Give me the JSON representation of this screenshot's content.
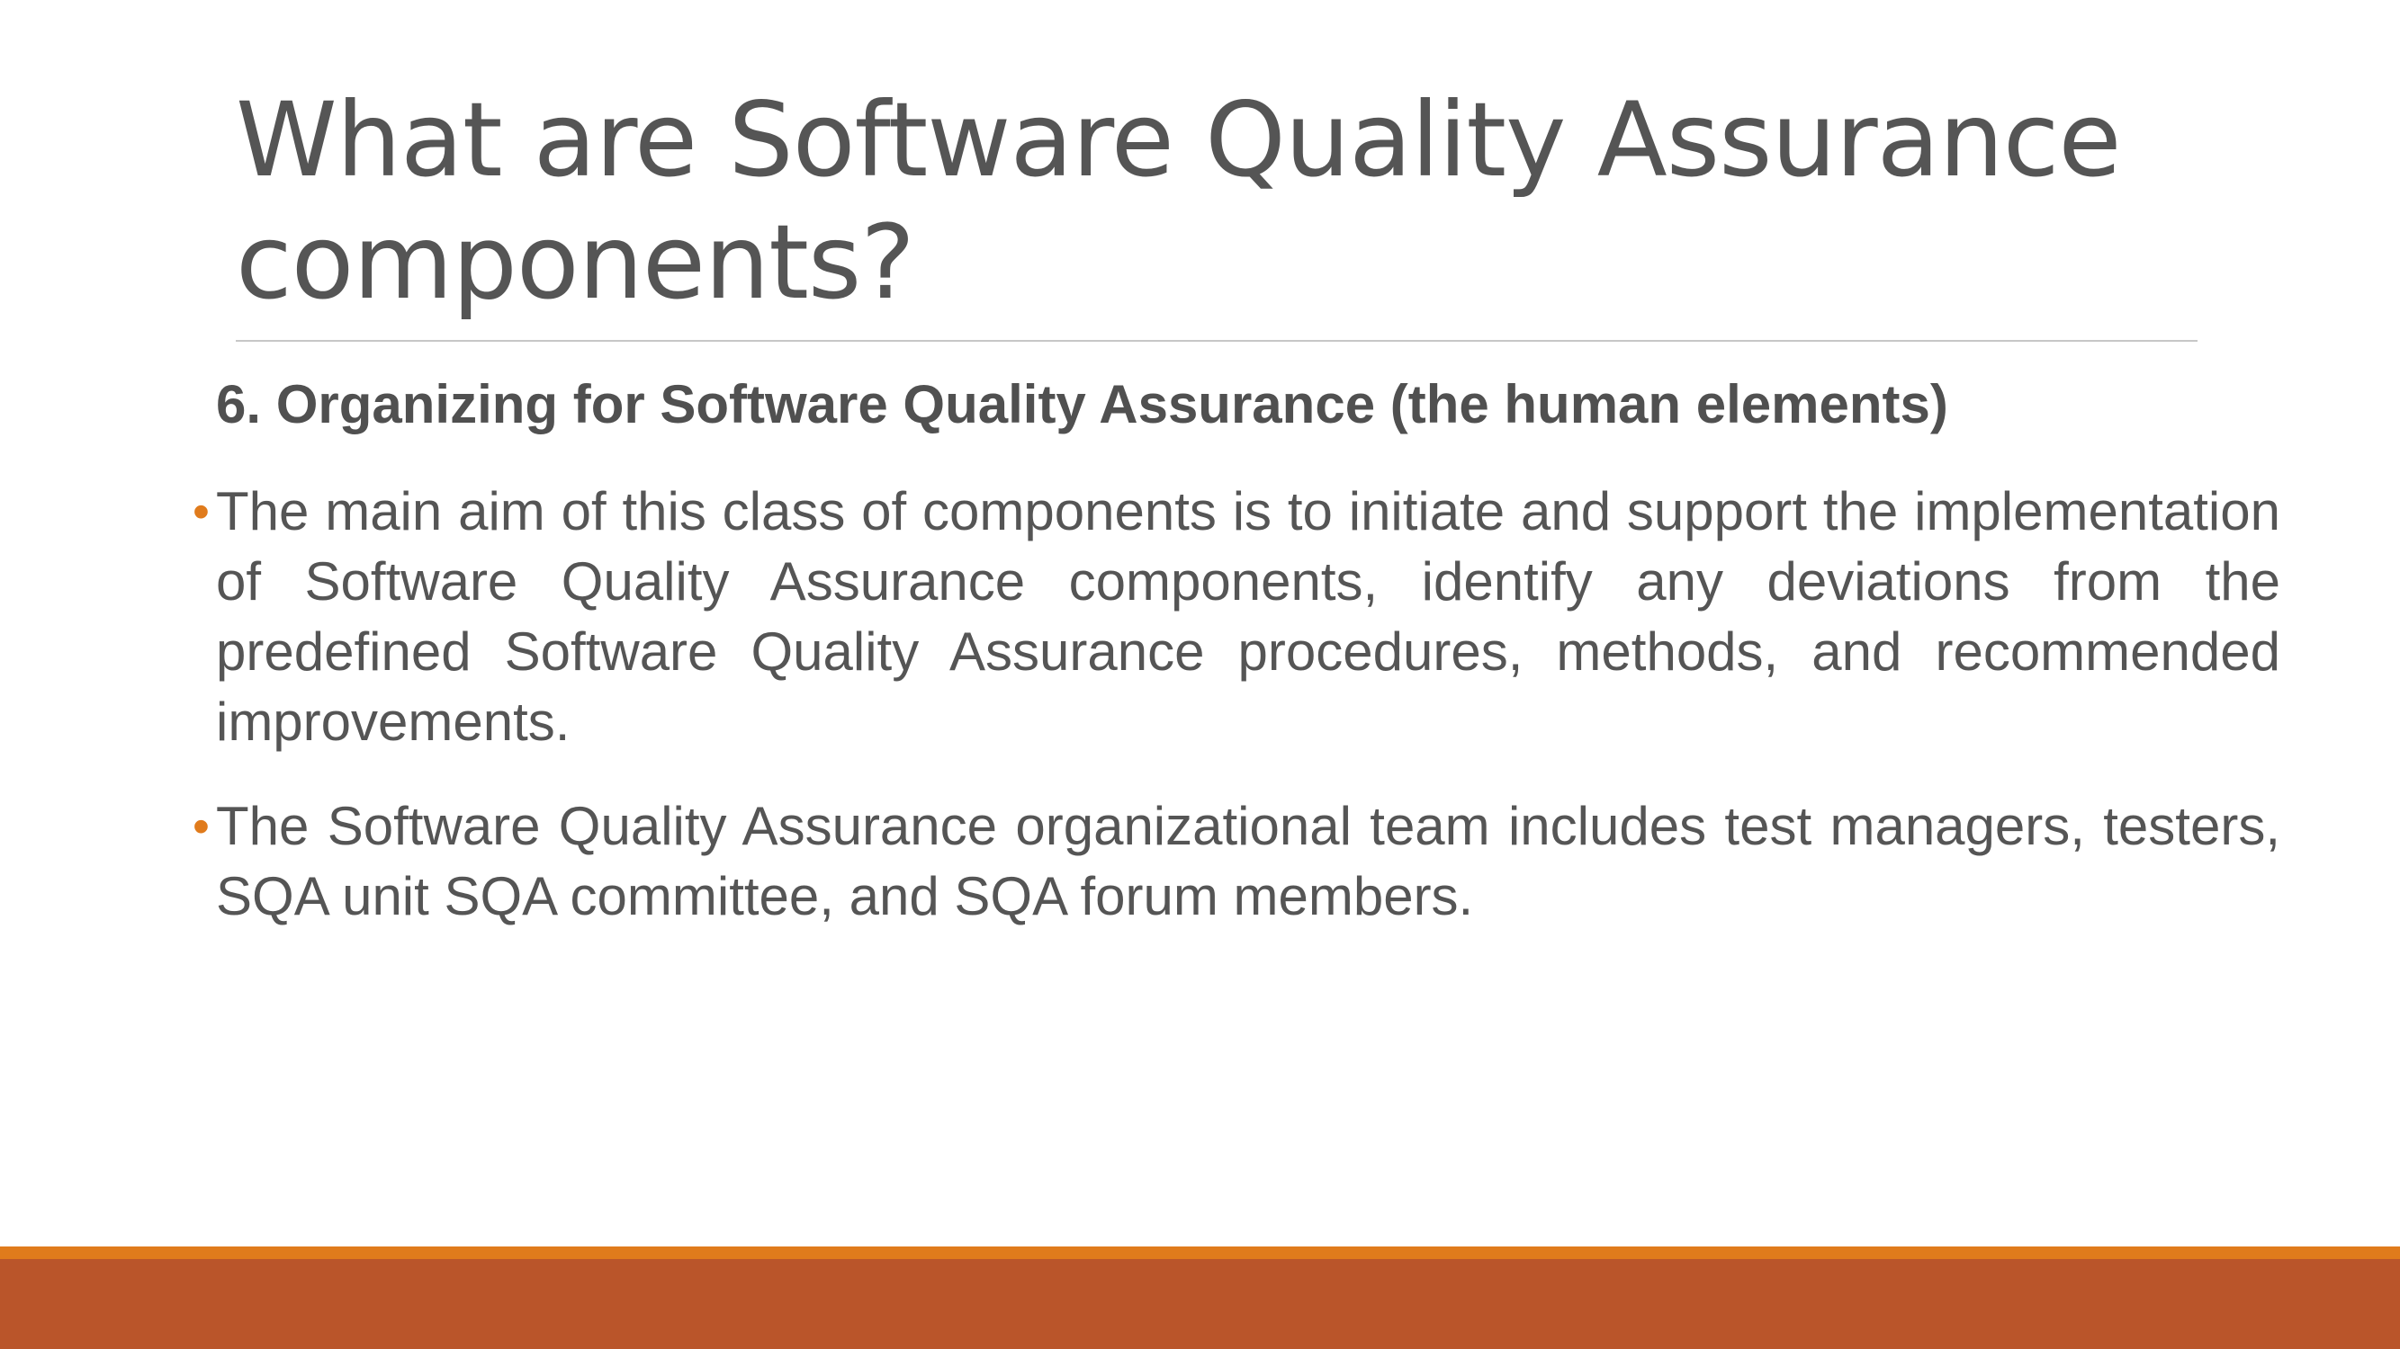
{
  "slide": {
    "title": "What are Software Quality Assurance components?",
    "subheading": "6. Organizing for Software Quality Assurance (the human elements)",
    "bullet_marker": "•",
    "bullets": [
      "The main aim of this class of components is to initiate and support the implementation of Software Quality Assurance components, identify any deviations from the predefined Software Quality Assurance procedures, methods, and recommended improvements.",
      "The Software Quality Assurance organizational team includes test managers, testers, SQA unit SQA committee, and SQA forum members."
    ]
  },
  "colors": {
    "accent": "#e07b1c",
    "footer": "#ba552a",
    "text": "#555555"
  }
}
